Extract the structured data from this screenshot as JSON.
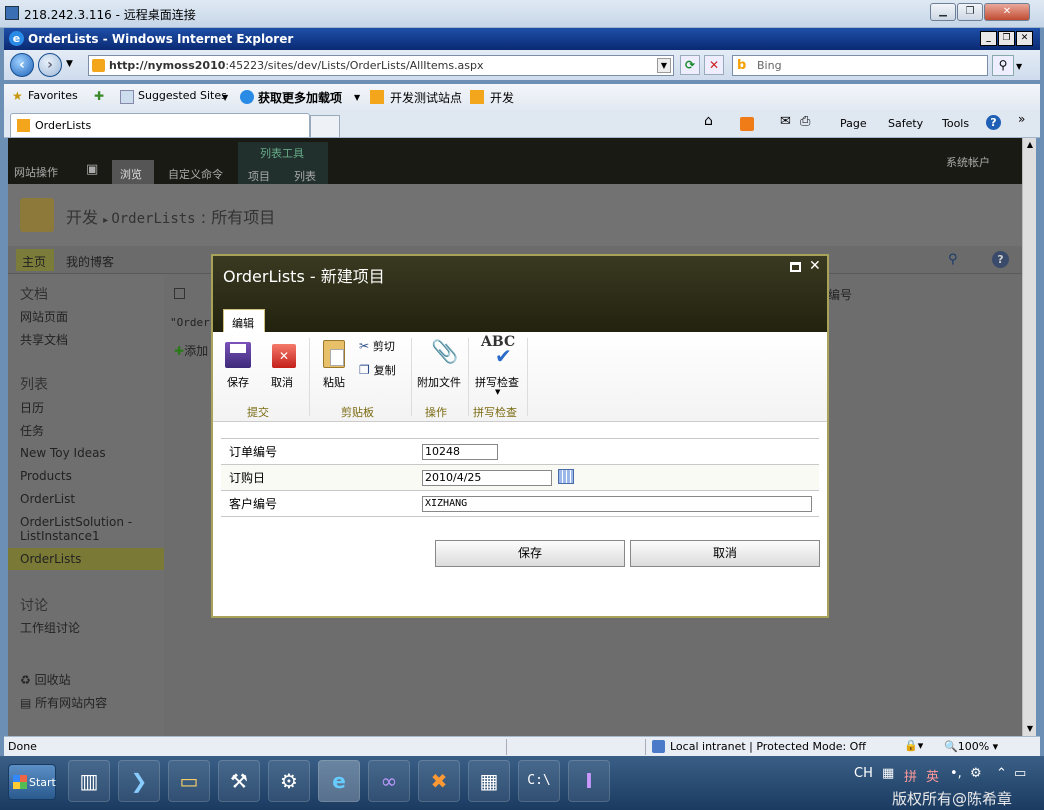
{
  "rdp": {
    "title": "218.242.3.116 - 远程桌面连接"
  },
  "ie": {
    "title": "OrderLists - Windows Internet Explorer",
    "url_host": "http://nymoss2010",
    "url_path": ":45223/sites/dev/Lists/OrderLists/AllItems.aspx",
    "search_placeholder": "Bing",
    "favorites": "Favorites",
    "fav_items": [
      "Suggested Sites",
      "获取更多加载项",
      "开发测试站点",
      "开发"
    ],
    "tab_label": "OrderLists",
    "commands": [
      "Page",
      "Safety",
      "Tools"
    ]
  },
  "sp": {
    "site_actions": "网站操作",
    "tab_browse": "浏览",
    "tab_custom": "自定义命令",
    "list_tools": "列表工具",
    "tab_items": "项目",
    "tab_list": "列表",
    "user": "系统帐户",
    "breadcrumb_site": "开发",
    "breadcrumb_list": "OrderLists",
    "breadcrumb_view": "所有项目",
    "topnav": [
      "主页",
      "我的博客"
    ],
    "content_header": "编号",
    "content_text": "\"OrderL",
    "add_new": "添加",
    "leftnav": {
      "docs_heading": "文档",
      "docs": [
        "网站页面",
        "共享文档"
      ],
      "lists_heading": "列表",
      "lists": [
        "日历",
        "任务",
        "New Toy Ideas",
        "Products",
        "OrderList",
        "OrderListSolution - ListInstance1",
        "OrderLists"
      ],
      "disc_heading": "讨论",
      "disc": [
        "工作组讨论"
      ],
      "recycle": "回收站",
      "all_content": "所有网站内容"
    }
  },
  "dialog": {
    "title": "OrderLists - 新建项目",
    "tab": "编辑",
    "buttons": {
      "save": "保存",
      "cancel": "取消",
      "paste": "粘贴",
      "cut": "剪切",
      "copy": "复制",
      "attach": "附加文件",
      "spell": "拼写检查"
    },
    "groups": [
      "提交",
      "剪贴板",
      "操作",
      "拼写检查"
    ],
    "fields": [
      {
        "label": "订单编号",
        "value": "10248"
      },
      {
        "label": "订购日",
        "value": "2010/4/25"
      },
      {
        "label": "客户编号",
        "value": "XIZHANG"
      }
    ],
    "save_btn": "保存",
    "cancel_btn": "取消"
  },
  "status": {
    "left": "Done",
    "zone": "Local intranet | Protected Mode: Off",
    "zoom": "100%"
  },
  "taskbar": {
    "start": "Start",
    "lang": "CH",
    "ime": "英"
  },
  "watermark": "版权所有@陈希章",
  "colors": {
    "ie_title": "#1e4fa8",
    "dialog_header": "#2c2c18",
    "sp_gold": "#a9a35a"
  }
}
